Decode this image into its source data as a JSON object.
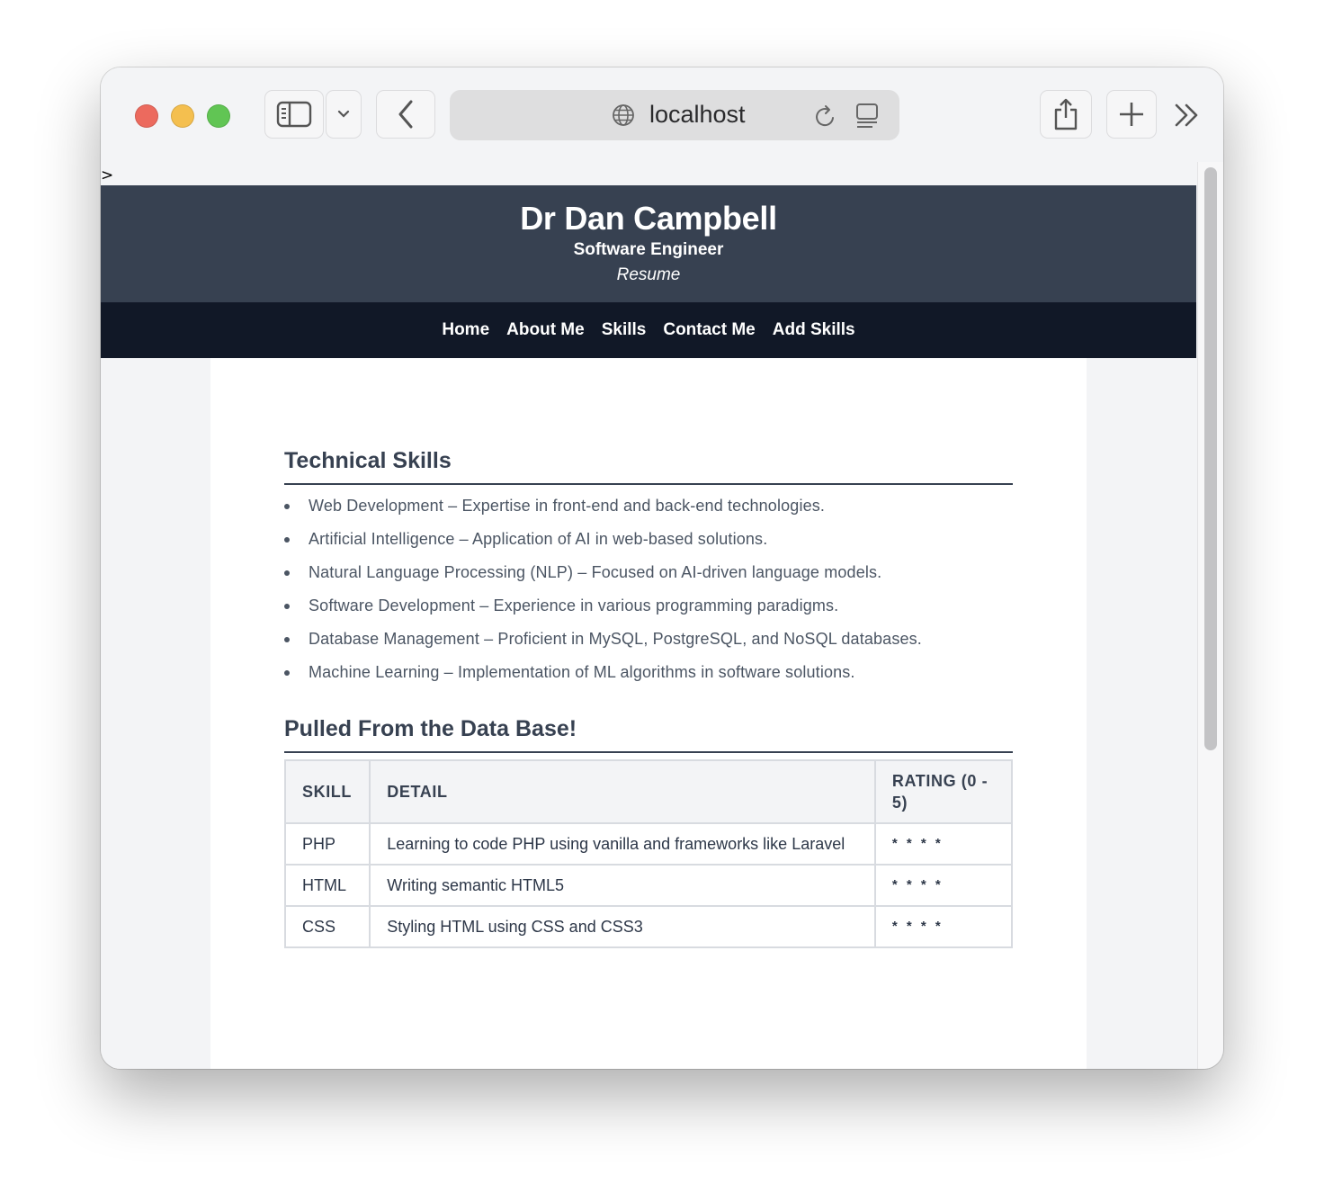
{
  "browser": {
    "url": "localhost"
  },
  "page_prefix": ">",
  "header": {
    "name": "Dr Dan Campbell",
    "role": "Software Engineer",
    "tag": "Resume"
  },
  "nav": {
    "items": [
      "Home",
      "About Me",
      "Skills",
      "Contact Me",
      "Add Skills"
    ]
  },
  "technical_skills": {
    "heading": "Technical Skills",
    "items": [
      "Web Development – Expertise in front-end and back-end technologies.",
      "Artificial Intelligence – Application of AI in web-based solutions.",
      "Natural Language Processing (NLP) – Focused on AI-driven language models.",
      "Software Development – Experience in various programming paradigms.",
      "Database Management – Proficient in MySQL, PostgreSQL, and NoSQL databases.",
      "Machine Learning – Implementation of ML algorithms in software solutions."
    ]
  },
  "db_skills": {
    "heading": "Pulled From the Data Base!",
    "columns": [
      "SKILL",
      "DETAIL",
      "RATING (0 - 5)"
    ],
    "rows": [
      {
        "skill": "PHP",
        "detail": "Learning to code PHP using vanilla and frameworks like Laravel",
        "rating": "* * * *"
      },
      {
        "skill": "HTML",
        "detail": "Writing semantic HTML5",
        "rating": "* * * *"
      },
      {
        "skill": "CSS",
        "detail": "Styling HTML using CSS and CSS3",
        "rating": "* * * *"
      }
    ]
  }
}
